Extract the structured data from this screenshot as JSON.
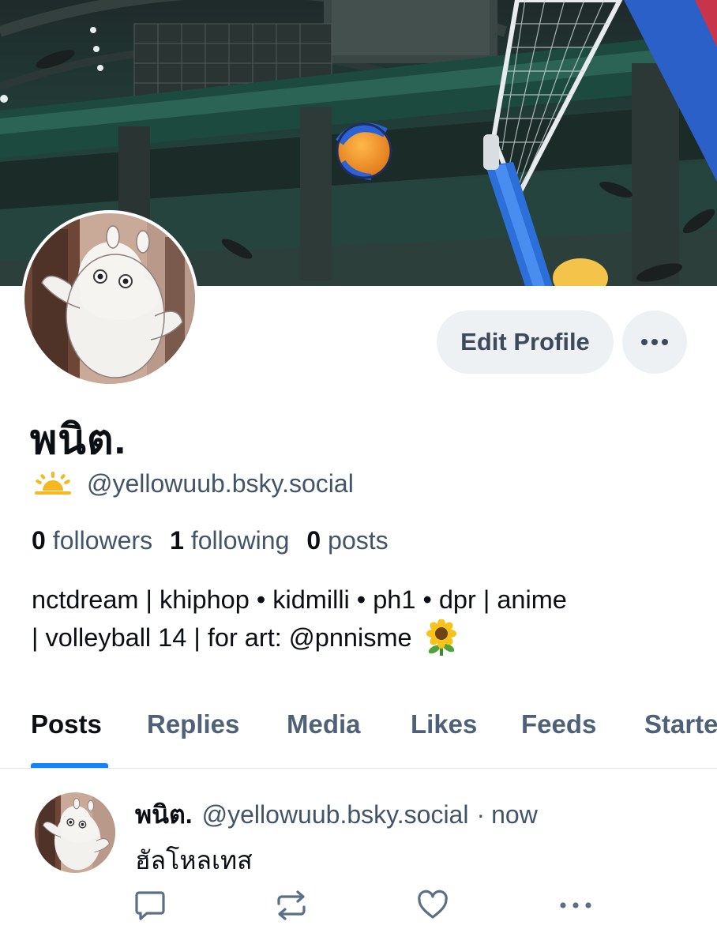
{
  "profile": {
    "display_name": "พนิต.",
    "handle": "@yellowuub.bsky.social",
    "handle_icon": "sunrise-emoji",
    "avatar_icon": "moomin-avatar",
    "followers_count": "0",
    "followers_label": "followers",
    "following_count": "1",
    "following_label": "following",
    "posts_count": "0",
    "posts_label": "posts",
    "bio_line1": "nctdream | khiphop • kidmilli • ph1 • dpr | anime",
    "bio_line2": "| volleyball 14 | for art: @pnnisme",
    "bio_emoji": "sunflower-emoji"
  },
  "actions": {
    "edit_profile_label": "Edit Profile",
    "more_icon": "ellipsis-icon"
  },
  "tabs": [
    {
      "label": "Posts",
      "active": true
    },
    {
      "label": "Replies",
      "active": false
    },
    {
      "label": "Media",
      "active": false
    },
    {
      "label": "Likes",
      "active": false
    },
    {
      "label": "Feeds",
      "active": false
    },
    {
      "label": "Starter",
      "active": false
    }
  ],
  "post": {
    "author": "พนิต.",
    "handle": "@yellowuub.bsky.social",
    "separator": "·",
    "time": "now",
    "text": "ฮัลโหลเทส",
    "action_icons": [
      "reply-icon",
      "repost-icon",
      "like-icon",
      "more-icon"
    ]
  },
  "colors": {
    "accent": "#1083fe",
    "muted_text": "#425468",
    "button_bg": "#eef1f4"
  }
}
